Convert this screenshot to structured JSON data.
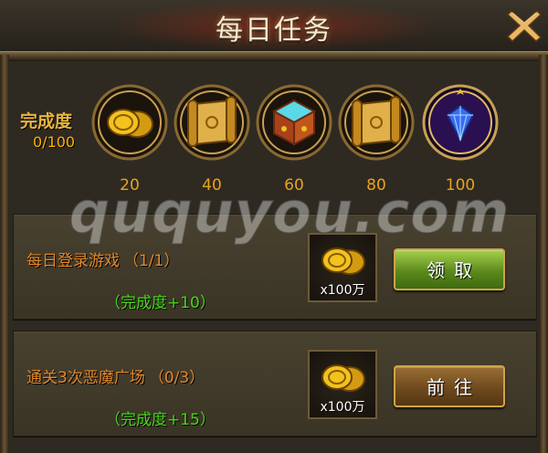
{
  "window": {
    "title": "每日任务"
  },
  "progress": {
    "label": "完成度",
    "value": "0/100"
  },
  "milestones": [
    {
      "value": "20",
      "reward_icon": "gold-coins-icon"
    },
    {
      "value": "40",
      "reward_icon": "scroll-icon"
    },
    {
      "value": "60",
      "reward_icon": "treasure-chest-icon"
    },
    {
      "value": "80",
      "reward_icon": "scroll-icon"
    },
    {
      "value": "100",
      "reward_icon": "blue-diamond-icon"
    }
  ],
  "tasks": [
    {
      "name": "每日登录游戏",
      "progress": "（1/1）",
      "reward_text": "（完成度+10）",
      "item_icon": "gold-coins-icon",
      "item_qty": "x100万",
      "button_label": "领取",
      "button_state": "claim"
    },
    {
      "name": "通关3次恶魔广场",
      "progress": "（0/3）",
      "reward_text": "（完成度+15）",
      "item_icon": "gold-coins-icon",
      "item_qty": "x100万",
      "button_label": "前往",
      "button_state": "go"
    }
  ],
  "watermark": "ququyou.com",
  "colors": {
    "accent_gold": "#e8b53c",
    "task_name": "#e3882a",
    "reward_green": "#4ad41e",
    "claim_button": "#5c8a1c",
    "go_button": "#6e4a1e"
  }
}
